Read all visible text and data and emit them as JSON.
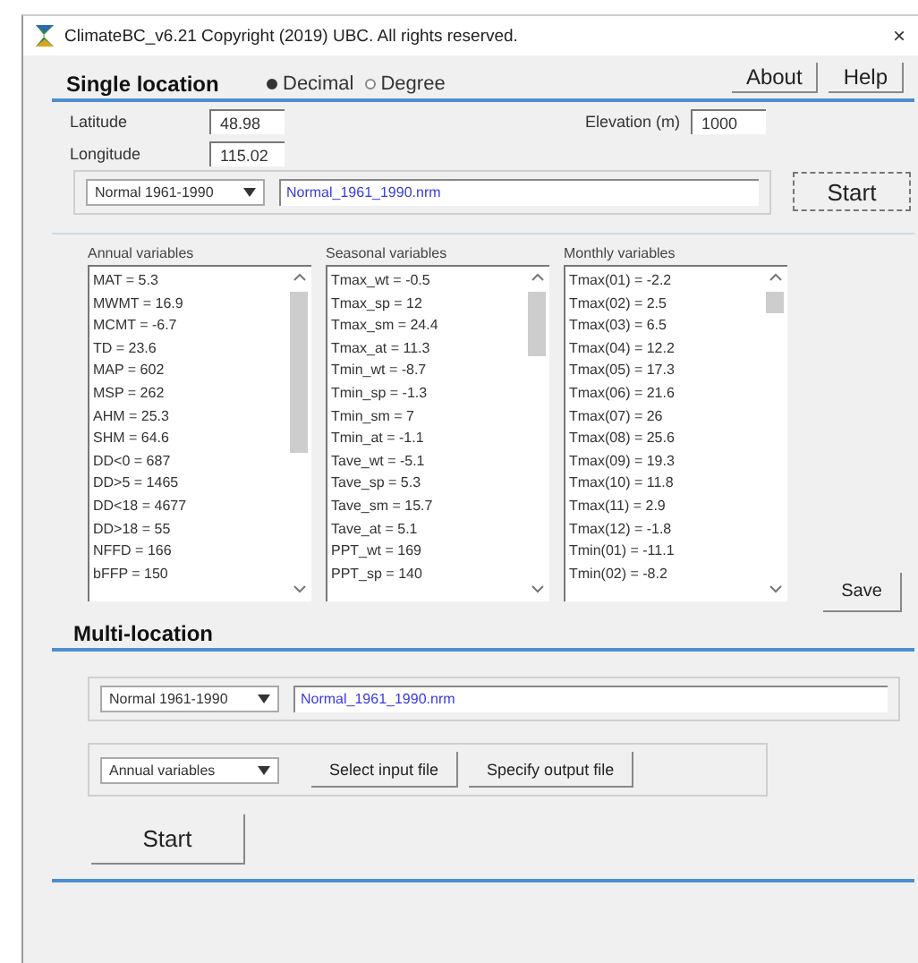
{
  "window": {
    "title": "ClimateBC_v6.21  Copyright (2019) UBC. All rights reserved.",
    "close": "×"
  },
  "single_location": {
    "heading": "Single location",
    "formats": [
      {
        "label": "Decimal",
        "selected": true
      },
      {
        "label": "Degree",
        "selected": false
      }
    ],
    "buttons": [
      "About",
      "Help"
    ],
    "latitude": {
      "label": "Latitude",
      "value": "48.98"
    },
    "longitude": {
      "label": "Longitude",
      "value": "115.02"
    },
    "elevation": {
      "label": "Elevation (m)",
      "value": "1000"
    },
    "period": "Normal 1961-1990",
    "file": "Normal_1961_1990.nrm",
    "start": "Start",
    "lists": [
      {
        "label": "Annual variables",
        "items": [
          "MAT = 5.3",
          "MWMT = 16.9",
          "MCMT = -6.7",
          "TD = 23.6",
          "MAP = 602",
          "MSP = 262",
          "AHM = 25.3",
          "SHM = 64.6",
          "DD<0 = 687",
          "DD>5 = 1465",
          "DD<18 = 4677",
          "DD>18 = 55",
          "NFFD = 166",
          "bFFP = 150"
        ]
      },
      {
        "label": "Seasonal variables",
        "items": [
          "Tmax_wt = -0.5",
          "Tmax_sp = 12",
          "Tmax_sm = 24.4",
          "Tmax_at = 11.3",
          "Tmin_wt = -8.7",
          "Tmin_sp = -1.3",
          "Tmin_sm = 7",
          "Tmin_at = -1.1",
          "Tave_wt = -5.1",
          "Tave_sp = 5.3",
          "Tave_sm = 15.7",
          "Tave_at = 5.1",
          "PPT_wt = 169",
          "PPT_sp = 140"
        ]
      },
      {
        "label": "Monthly variables",
        "items": [
          "Tmax(01) = -2.2",
          "Tmax(02) = 2.5",
          "Tmax(03) = 6.5",
          "Tmax(04) = 12.2",
          "Tmax(05) = 17.3",
          "Tmax(06) = 21.6",
          "Tmax(07) = 26",
          "Tmax(08) = 25.6",
          "Tmax(09) = 19.3",
          "Tmax(10) = 11.8",
          "Tmax(11) = 2.9",
          "Tmax(12) = -1.8",
          "Tmin(01) = -11.1",
          "Tmin(02) = -8.2"
        ]
      }
    ],
    "save": "Save"
  },
  "multi_location": {
    "heading": "Multi-location",
    "period": "Normal 1961-1990",
    "file": "Normal_1961_1990.nrm",
    "variables": "Annual variables",
    "buttons": [
      "Select input file",
      "Specify output file"
    ],
    "start": "Start"
  }
}
